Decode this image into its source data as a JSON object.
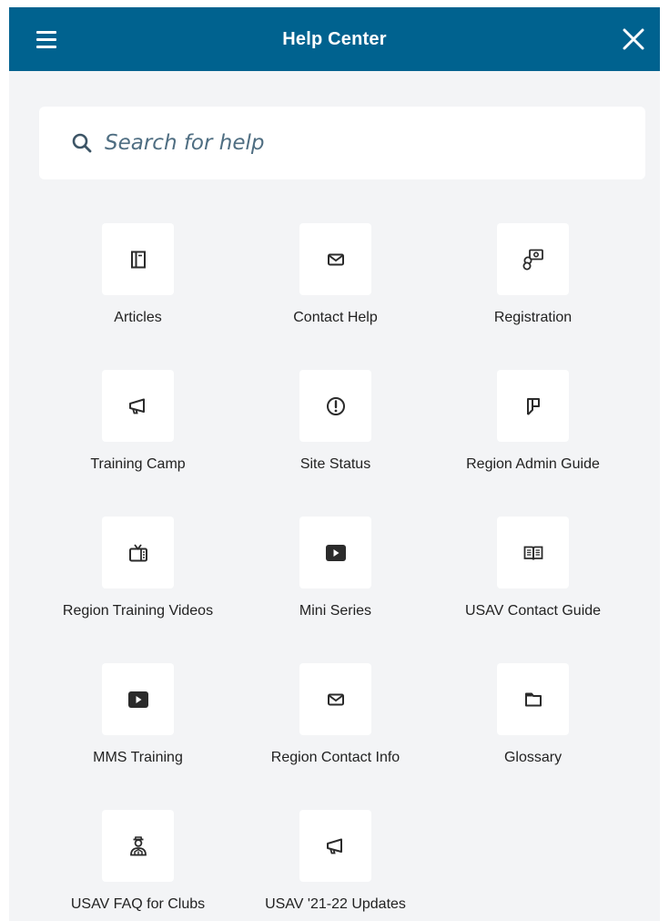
{
  "header": {
    "title": "Help Center",
    "menu_icon": "hamburger-menu-icon",
    "close_icon": "close-icon"
  },
  "search": {
    "placeholder": "Search for help",
    "icon": "search-icon"
  },
  "colors": {
    "header_bg": "#00628f",
    "panel_bg": "#f3f4f6",
    "tile_bg": "#ffffff",
    "icon": "#2b2b2b"
  },
  "tiles": [
    {
      "label": "Articles",
      "icon": "article-icon"
    },
    {
      "label": "Contact Help",
      "icon": "envelope-icon"
    },
    {
      "label": "Registration",
      "icon": "coins-money-icon"
    },
    {
      "label": "Training Camp",
      "icon": "megaphone-icon"
    },
    {
      "label": "Site Status",
      "icon": "alert-circle-icon"
    },
    {
      "label": "Region Admin Guide",
      "icon": "bookmark-flag-icon"
    },
    {
      "label": "Region Training Videos",
      "icon": "tv-icon"
    },
    {
      "label": "Mini Series",
      "icon": "youtube-play-icon"
    },
    {
      "label": "USAV Contact Guide",
      "icon": "open-book-icon"
    },
    {
      "label": "MMS Training",
      "icon": "youtube-play-icon"
    },
    {
      "label": "Region Contact Info",
      "icon": "envelope-icon"
    },
    {
      "label": "Glossary",
      "icon": "folder-icon"
    },
    {
      "label": "USAV FAQ for Clubs",
      "icon": "user-support-icon"
    },
    {
      "label": "USAV '21-22 Updates",
      "icon": "megaphone-icon"
    }
  ]
}
